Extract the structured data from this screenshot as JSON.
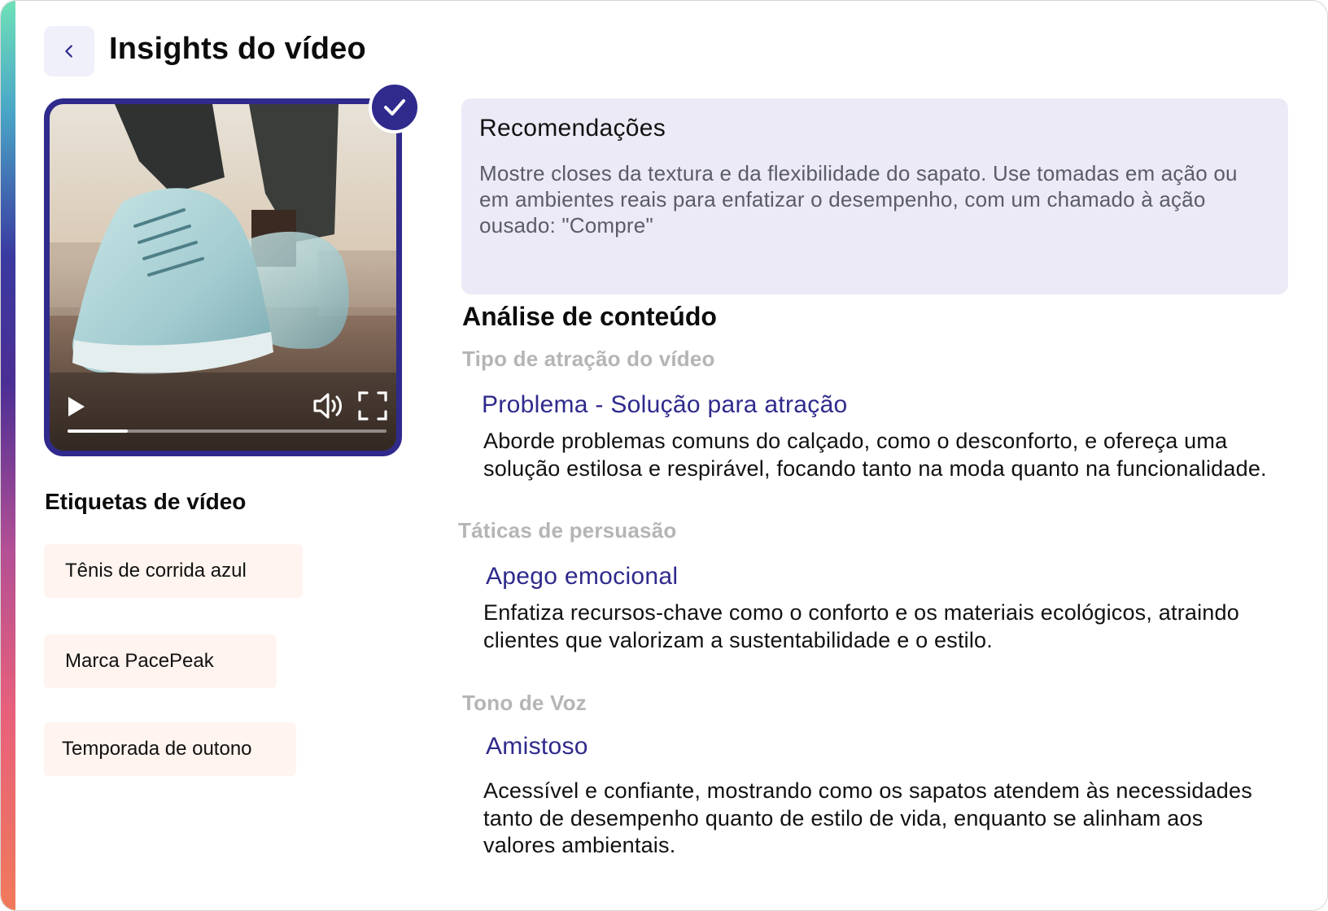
{
  "header": {
    "title": "Insights do vídeo"
  },
  "video": {
    "progress": 0.19,
    "verified": true
  },
  "tags": {
    "title": "Etiquetas de vídeo",
    "items": [
      "Tênis de corrida azul",
      "Marca PacePeak",
      "Temporada de outono"
    ]
  },
  "recommendations": {
    "title": "Recomendações",
    "body": "Mostre closes da textura e da flexibilidade do sapato. Use tomadas em ação ou em ambientes reais para enfatizar o desempenho, com um chamado à ação ousado: \"Compre\""
  },
  "analysis": {
    "title": "Análise de conteúdo",
    "sections": [
      {
        "label": "Tipo de atração do vídeo",
        "heading": "Problema - Solução para atração",
        "body": "Aborde problemas comuns do calçado, como o desconforto, e ofereça uma solução estilosa e respirável, focando tanto na moda quanto na funcionalidade."
      },
      {
        "label": "Táticas de persuasão",
        "heading": "Apego emocional",
        "body": "Enfatiza recursos-chave como o conforto e os materiais ecológicos, atraindo clientes que valorizam a sustentabilidade e o estilo."
      },
      {
        "label": "Tono de Voz",
        "heading": "Amistoso",
        "body": "Acessível e confiante, mostrando como os sapatos atendem às necessidades tanto de desempenho quanto de estilo de vida, enquanto se alinham aos valores ambientais."
      }
    ]
  },
  "colors": {
    "accent": "#2f2a8c",
    "tag_bg": "#fff4ef",
    "rec_bg": "#ebeaf6"
  }
}
